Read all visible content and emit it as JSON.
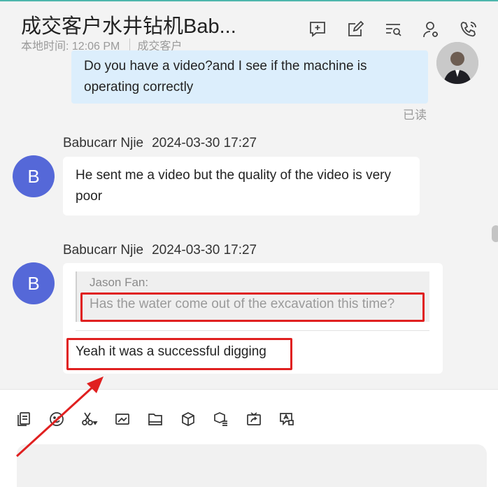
{
  "header": {
    "title": "成交客户水井钻机Bab...",
    "local_time": "本地时间: 12:06 PM",
    "tag": "成交客户",
    "icons": [
      "chat-plus-icon",
      "edit-icon",
      "search-list-icon",
      "contact-settings-icon",
      "phone-icon"
    ]
  },
  "messages": [
    {
      "from": "self",
      "text": "Do you have a video?and I see if the machine is operating correctly",
      "status": "已读"
    },
    {
      "from": "Babucarr Njie",
      "avatar_letter": "B",
      "time": "2024-03-30 17:27",
      "text": "He sent me a video but the quality of the video is very poor"
    },
    {
      "from": "Babucarr Njie",
      "avatar_letter": "B",
      "time": "2024-03-30 17:27",
      "quote": {
        "name": "Jason Fan:",
        "text": "Has the water come out of the excavation this time?"
      },
      "text": "Yeah it was a successful digging"
    }
  ],
  "composer": {
    "tools": [
      "clipboard-icon",
      "emoji-icon",
      "scissors-icon",
      "image-icon",
      "folder-icon",
      "product-box-icon",
      "catalog-icon",
      "video-share-icon",
      "translate-icon"
    ]
  },
  "colors": {
    "accent": "#4db6ac",
    "avatar": "#5568d8",
    "self_bubble": "#dceefc",
    "highlight": "#e02020"
  }
}
